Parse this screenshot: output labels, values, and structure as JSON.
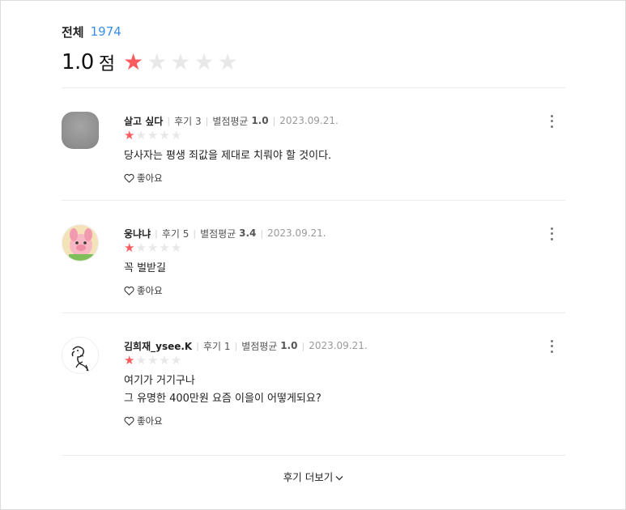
{
  "summary": {
    "total_label": "전체",
    "total_count": "1974",
    "score": "1.0",
    "score_unit": "점",
    "rating": 1,
    "max_rating": 5
  },
  "reviews": [
    {
      "nickname": "살고 싶다",
      "review_count": "후기 3",
      "avg_label": "별점평균",
      "avg_value": "1.0",
      "date": "2023.09.21.",
      "rating": 1,
      "text": "당사자는 평생 죄값을 제대로 치뤄야 할 것이다.",
      "like_label": "좋아요",
      "avatar_icon": "gray-avatar"
    },
    {
      "nickname": "웅냐냐",
      "review_count": "후기 5",
      "avg_label": "별점평균",
      "avg_value": "3.4",
      "date": "2023.09.21.",
      "rating": 1,
      "text": "꼭 벌받길",
      "like_label": "좋아요",
      "avatar_icon": "piglet-avatar"
    },
    {
      "nickname": "김희재_ysee.K",
      "review_count": "후기 1",
      "avg_label": "별점평균",
      "avg_value": "1.0",
      "date": "2023.09.21.",
      "rating": 1,
      "text": "여기가 거기구나\n그 유명한  400만원 요즘 이을이 어떻게되요?",
      "like_label": "좋아요",
      "avatar_icon": "dog-sketch-avatar"
    }
  ],
  "more_label": "후기 더보기",
  "colors": {
    "star_on": "#fa5b5f",
    "star_off": "#e8e8e8",
    "count_blue": "#3a8ee6"
  }
}
